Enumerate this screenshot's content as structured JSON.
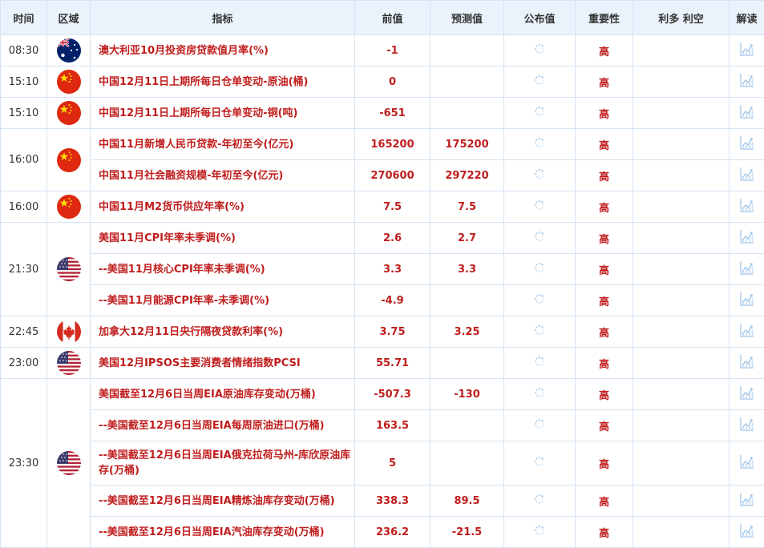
{
  "headers": {
    "time": "时间",
    "region": "区域",
    "indicator": "指标",
    "previous": "前值",
    "forecast": "预测值",
    "actual": "公布值",
    "importance": "重要性",
    "impact": "利多 利空",
    "analysis": "解读"
  },
  "groups": [
    {
      "time": "08:30",
      "flag": "australia-flag",
      "events": [
        {
          "indicator": "澳大利亚10月投资房贷款值月率(%)",
          "previous": "-1",
          "forecast": "",
          "importance": "高"
        }
      ]
    },
    {
      "time": "15:10",
      "flag": "china-flag",
      "events": [
        {
          "indicator": "中国12月11日上期所每日仓单变动-原油(桶)",
          "previous": "0",
          "forecast": "",
          "importance": "高"
        }
      ]
    },
    {
      "time": "15:10",
      "flag": "china-flag",
      "events": [
        {
          "indicator": "中国12月11日上期所每日仓单变动-铜(吨)",
          "previous": "-651",
          "forecast": "",
          "importance": "高"
        }
      ]
    },
    {
      "time": "16:00",
      "flag": "china-flag",
      "events": [
        {
          "indicator": "中国11月新增人民币贷款-年初至今(亿元)",
          "previous": "165200",
          "forecast": "175200",
          "importance": "高"
        },
        {
          "indicator": "中国11月社会融资规模-年初至今(亿元)",
          "previous": "270600",
          "forecast": "297220",
          "importance": "高"
        }
      ]
    },
    {
      "time": "16:00",
      "flag": "china-flag",
      "events": [
        {
          "indicator": "中国11月M2货币供应年率(%)",
          "previous": "7.5",
          "forecast": "7.5",
          "importance": "高"
        }
      ]
    },
    {
      "time": "21:30",
      "flag": "usa-flag",
      "events": [
        {
          "indicator": "美国11月CPI年率未季调(%)",
          "previous": "2.6",
          "forecast": "2.7",
          "importance": "高"
        },
        {
          "indicator": "--美国11月核心CPI年率未季调(%)",
          "previous": "3.3",
          "forecast": "3.3",
          "importance": "高"
        },
        {
          "indicator": "--美国11月能源CPI年率-未季调(%)",
          "previous": "-4.9",
          "forecast": "",
          "importance": "高"
        }
      ]
    },
    {
      "time": "22:45",
      "flag": "canada-flag",
      "events": [
        {
          "indicator": "加拿大12月11日央行隔夜贷款利率(%)",
          "previous": "3.75",
          "forecast": "3.25",
          "importance": "高"
        }
      ]
    },
    {
      "time": "23:00",
      "flag": "usa-flag",
      "events": [
        {
          "indicator": "美国12月IPSOS主要消费者情绪指数PCSI",
          "previous": "55.71",
          "forecast": "",
          "importance": "高"
        }
      ]
    },
    {
      "time": "23:30",
      "flag": "usa-flag",
      "events": [
        {
          "indicator": "美国截至12月6日当周EIA原油库存变动(万桶)",
          "previous": "-507.3",
          "forecast": "-130",
          "importance": "高"
        },
        {
          "indicator": "--美国截至12月6日当周EIA每周原油进口(万桶)",
          "previous": "163.5",
          "forecast": "",
          "importance": "高"
        },
        {
          "indicator": "--美国截至12月6日当周EIA俄克拉荷马州-库欣原油库存(万桶)",
          "previous": "5",
          "forecast": "",
          "importance": "高"
        },
        {
          "indicator": "--美国截至12月6日当周EIA精炼油库存变动(万桶)",
          "previous": "338.3",
          "forecast": "89.5",
          "importance": "高"
        },
        {
          "indicator": "--美国截至12月6日当周EIA汽油库存变动(万桶)",
          "previous": "236.2",
          "forecast": "-21.5",
          "importance": "高"
        }
      ]
    }
  ],
  "colors": {
    "header_bg": "#eaf3fc",
    "border": "#d4e3f3",
    "accent_red": "#c01d1d",
    "icon_blue": "#9ec3e6"
  }
}
